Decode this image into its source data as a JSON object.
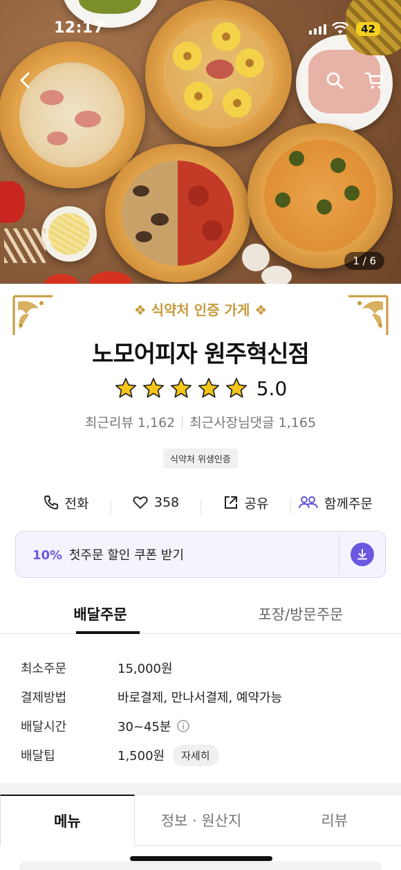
{
  "status_bar": {
    "time": "12:17",
    "battery": "42"
  },
  "hero": {
    "image_counter": "1 / 6"
  },
  "store": {
    "certification_banner": "식약처 인증 가게",
    "name": "노모어피자 원주혁신점",
    "rating": "5.0",
    "stars": 5,
    "recent_reviews": "최근리뷰 1,162",
    "owner_replies": "최근사장님댓글 1,165",
    "hygiene_badge": "식약처 위생인증"
  },
  "actions": {
    "call": "전화",
    "likes": "358",
    "share": "공유",
    "group_order": "함께주문"
  },
  "coupon": {
    "percent": "10%",
    "text": "첫주문 할인 쿠폰 받기"
  },
  "order_tabs": [
    {
      "label": "배달주문",
      "active": true
    },
    {
      "label": "포장/방문주문",
      "active": false
    }
  ],
  "delivery_info": {
    "min_order_label": "최소주문",
    "min_order_value": "15,000원",
    "payment_label": "결제방법",
    "payment_value": "바로결제, 만나서결제, 예약가능",
    "time_label": "배달시간",
    "time_value": "30~45분",
    "tip_label": "배달팁",
    "tip_value": "1,500원",
    "tip_detail": "자세히"
  },
  "bottom_tabs": [
    {
      "label": "메뉴",
      "active": true
    },
    {
      "label": "정보 · 원산지",
      "active": false
    },
    {
      "label": "리뷰",
      "active": false
    }
  ],
  "colors": {
    "accent": "#6b58e0",
    "gold": "#c79a3c",
    "star": "#f5c518"
  }
}
